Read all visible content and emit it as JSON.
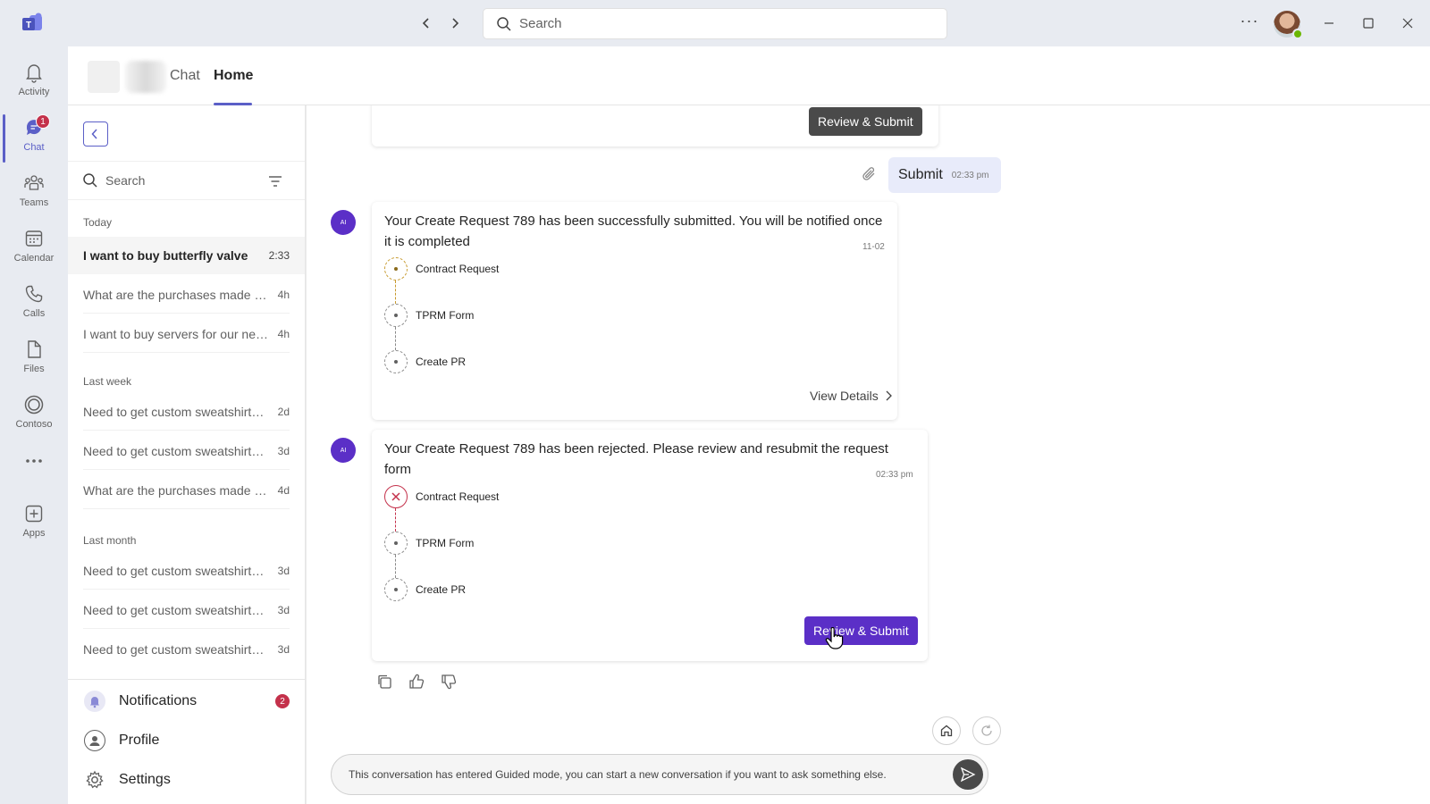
{
  "topbar": {
    "search_placeholder": "Search",
    "more_label": "···"
  },
  "rail": {
    "items": [
      {
        "label": "Activity",
        "icon": "bell-icon"
      },
      {
        "label": "Chat",
        "icon": "chat-icon",
        "badge": "1"
      },
      {
        "label": "Teams",
        "icon": "teams-icon"
      },
      {
        "label": "Calendar",
        "icon": "calendar-icon"
      },
      {
        "label": "Calls",
        "icon": "phone-icon"
      },
      {
        "label": "Files",
        "icon": "file-icon"
      },
      {
        "label": "Contoso",
        "icon": "contoso-icon"
      },
      {
        "label": "Apps",
        "icon": "add-app-icon"
      }
    ]
  },
  "header": {
    "tabs": [
      {
        "label": "Chat"
      },
      {
        "label": "Home"
      }
    ]
  },
  "sidebar": {
    "search_placeholder": "Search",
    "groups": [
      {
        "label": "Today",
        "items": [
          {
            "title": "I want to buy butterfly valve",
            "time": "2:33"
          },
          {
            "title": "What are the purchases made by my team",
            "time": "4h"
          },
          {
            "title": "I want to buy servers for our new office",
            "time": "4h"
          }
        ]
      },
      {
        "label": "Last week",
        "items": [
          {
            "title": "Need to get custom sweatshirts for the team",
            "time": "2d"
          },
          {
            "title": "Need to get custom sweatshirts for the team",
            "time": "3d"
          },
          {
            "title": "What are the purchases made by my team",
            "time": "4d"
          }
        ]
      },
      {
        "label": "Last month",
        "items": [
          {
            "title": "Need to get custom sweatshirts for the team",
            "time": "3d"
          },
          {
            "title": "Need to get custom sweatshirts for the team",
            "time": "3d"
          },
          {
            "title": "Need to get custom sweatshirts for the team",
            "time": "3d"
          }
        ]
      }
    ],
    "bottom": {
      "notifications": "Notifications",
      "notifications_badge": "2",
      "profile": "Profile",
      "settings": "Settings"
    }
  },
  "conversation": {
    "top_card_button": "Review & Submit",
    "user_message": {
      "text": "Submit",
      "time": "02:33 pm"
    },
    "bot_avatar": "AI",
    "message1": {
      "text": "Your Create Request 789 has been successfully submitted. You will be notified once it is completed",
      "time": "11-02",
      "steps": [
        "Contract Request",
        "TPRM Form",
        "Create PR"
      ],
      "link": "View Details"
    },
    "message2": {
      "text": "Your Create Request 789 has been rejected. Please review and resubmit the request form",
      "time": "02:33 pm",
      "steps": [
        "Contract Request",
        "TPRM Form",
        "Create PR"
      ],
      "button": "Review & Submit"
    },
    "composer_text": "This conversation has entered Guided mode, you can start a new conversation if you want to ask something else."
  },
  "colors": {
    "accent": "#5b5fc7",
    "primary_button": "#5b2fc7",
    "rejected": "#c4314b",
    "pending": "#c79a2e",
    "badge": "#c4314b"
  }
}
